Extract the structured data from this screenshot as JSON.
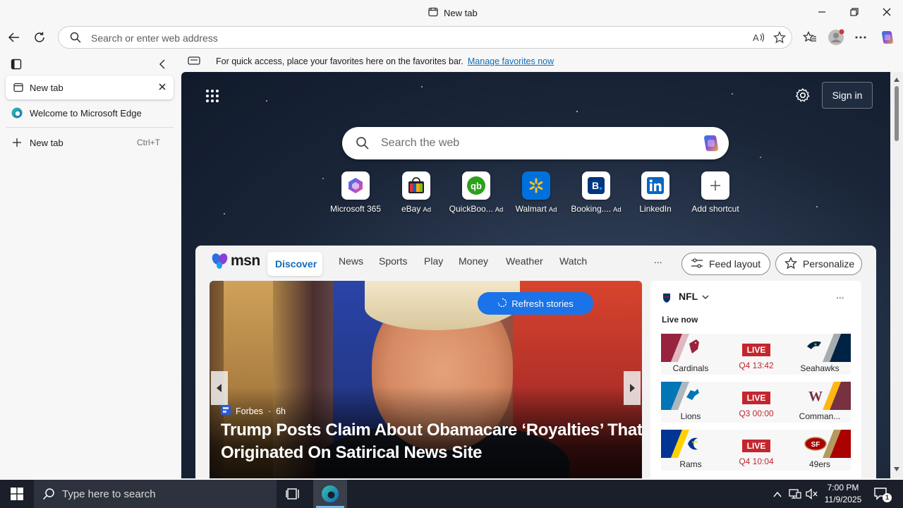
{
  "window": {
    "title": "New tab"
  },
  "addressbar": {
    "placeholder": "Search or enter web address"
  },
  "sidebar": {
    "tabs": [
      {
        "label": "New tab",
        "active": true
      },
      {
        "label": "Welcome to Microsoft Edge"
      }
    ],
    "new_tab": {
      "label": "New tab",
      "shortcut": "Ctrl+T"
    }
  },
  "favbar": {
    "message": "For quick access, place your favorites here on the favorites bar.",
    "link": "Manage favorites now"
  },
  "newtab": {
    "sign_in": "Sign in",
    "search_placeholder": "Search the web",
    "shortcuts": [
      {
        "label": "Microsoft 365",
        "ad": "",
        "icon": "microsoft-365-icon"
      },
      {
        "label": "eBay",
        "ad": "Ad",
        "icon": "ebay-icon"
      },
      {
        "label": "QuickBoo...",
        "ad": "Ad",
        "icon": "quickbooks-icon"
      },
      {
        "label": "Walmart",
        "ad": "Ad",
        "icon": "walmart-icon"
      },
      {
        "label": "Booking....",
        "ad": "Ad",
        "icon": "booking-icon"
      },
      {
        "label": "LinkedIn",
        "ad": "",
        "icon": "linkedin-icon"
      },
      {
        "label": "Add shortcut",
        "ad": "",
        "icon": "plus-icon"
      }
    ]
  },
  "msn": {
    "logo": "msn",
    "tabs": [
      "Discover",
      "News",
      "Sports",
      "Play",
      "Money",
      "Weather",
      "Watch"
    ],
    "more": "...",
    "feed_layout": "Feed layout",
    "personalize": "Personalize",
    "hero": {
      "refresh": "Refresh stories",
      "source": "Forbes",
      "age": "6h",
      "headline": "Trump Posts Claim About Obamacare ‘Royalties’ That Originated On Satirical News Site"
    },
    "nfl": {
      "title": "NFL",
      "live_now": "Live now",
      "more": "...",
      "games": [
        {
          "home": "Cardinals",
          "away": "Seahawks",
          "status": "LIVE",
          "clock": "Q4 13:42",
          "home_color": "#97233f",
          "away_color": "#002244"
        },
        {
          "home": "Lions",
          "away": "Comman...",
          "status": "LIVE",
          "clock": "Q3 00:00",
          "home_color": "#0076b6",
          "away_color": "#773141"
        },
        {
          "home": "Rams",
          "away": "49ers",
          "status": "LIVE",
          "clock": "Q4 10:04",
          "home_color": "#003594",
          "away_color": "#aa0000"
        }
      ]
    }
  },
  "taskbar": {
    "search_placeholder": "Type here to search",
    "time": "7:00 PM",
    "date": "11/9/2025",
    "notification_count": "1"
  },
  "colors": {
    "accent": "#0f6cbd",
    "live": "#c4262e",
    "refresh": "#1a73e8"
  }
}
